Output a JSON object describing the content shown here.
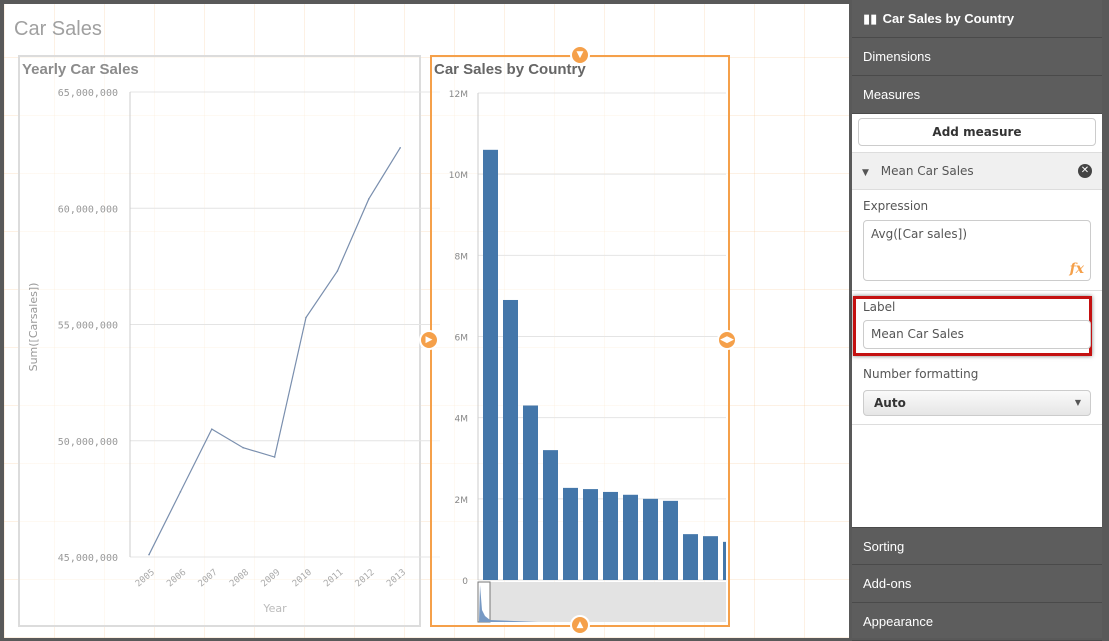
{
  "sheet": {
    "title": "Car Sales"
  },
  "colors": {
    "accent": "#f5a04a",
    "bar": "#4477aa",
    "line": "#7a8fae",
    "highlight": "#c41111"
  },
  "chart_data": [
    {
      "type": "line",
      "title": "Yearly Car Sales",
      "xlabel": "Year",
      "ylabel": "Sum([Carsales])",
      "x": [
        "2005",
        "2006",
        "2007",
        "2008",
        "2009",
        "2010",
        "2011",
        "2012",
        "2013"
      ],
      "values": [
        45100000,
        47800000,
        50500000,
        49700000,
        49300000,
        55300000,
        57300000,
        60400000,
        62600000
      ],
      "ylim": [
        45000000,
        65000000
      ],
      "yticks": [
        "45,000,000",
        "50,000,000",
        "55,000,000",
        "60,000,000",
        "65,000,000"
      ],
      "grid": true
    },
    {
      "type": "bar",
      "title": "Car Sales by Country",
      "values": [
        10600000,
        6900000,
        4300000,
        3200000,
        2270000,
        2240000,
        2170000,
        2100000,
        2000000,
        1950000,
        1130000,
        1080000,
        940000
      ],
      "ylim": [
        0,
        12000000
      ],
      "yticks": [
        "0",
        "2M",
        "4M",
        "6M",
        "8M",
        "10M",
        "12M"
      ],
      "grid": true,
      "scrollbar": true
    }
  ],
  "panel": {
    "title": "Car Sales by Country",
    "icon": "bar-chart-icon",
    "sections": {
      "dimensions": "Dimensions",
      "measures": "Measures",
      "sorting": "Sorting",
      "addons": "Add-ons",
      "appearance": "Appearance"
    },
    "add_measure": "Add measure",
    "measure": {
      "name": "Mean Car Sales",
      "expression_label": "Expression",
      "expression": "Avg([Car sales])",
      "label_label": "Label",
      "label_value": "Mean Car Sales",
      "number_formatting_label": "Number formatting",
      "number_formatting": "Auto"
    }
  }
}
